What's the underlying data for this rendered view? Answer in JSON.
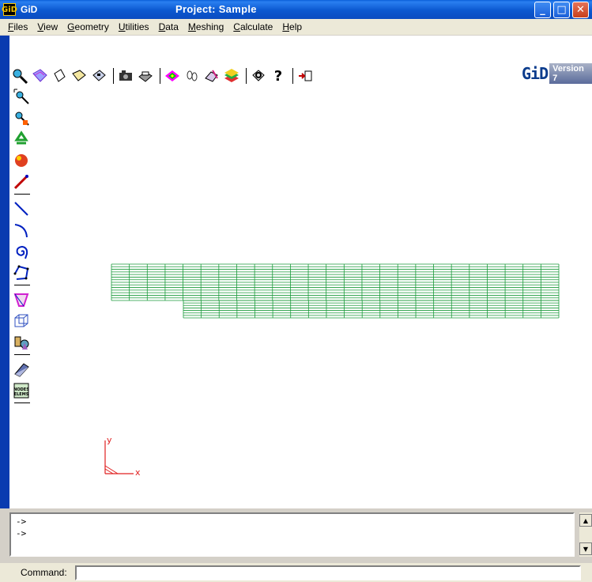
{
  "window": {
    "app_logo": "GiD",
    "app_name": "GiD",
    "title": "Project: Sample",
    "min_glyph": "_",
    "max_glyph": "□",
    "close_glyph": "✕"
  },
  "menu": [
    {
      "label": "Files",
      "mnemonic": "F",
      "rest": "iles"
    },
    {
      "label": "View",
      "mnemonic": "V",
      "rest": "iew"
    },
    {
      "label": "Geometry",
      "mnemonic": "G",
      "rest": "eometry"
    },
    {
      "label": "Utilities",
      "mnemonic": "U",
      "rest": "tilities"
    },
    {
      "label": "Data",
      "mnemonic": "D",
      "rest": "ata"
    },
    {
      "label": "Meshing",
      "mnemonic": "M",
      "rest": "eshing"
    },
    {
      "label": "Calculate",
      "mnemonic": "C",
      "rest": "alculate"
    },
    {
      "label": "Help",
      "mnemonic": "H",
      "rest": "elp"
    }
  ],
  "brand": {
    "logo": "GiD",
    "version": "Version 7"
  },
  "axis": {
    "x": "x",
    "y": "y"
  },
  "console": {
    "lines": [
      "->",
      "->"
    ]
  },
  "command": {
    "label": "Command:",
    "value": ""
  },
  "colors": {
    "mesh": "#1a9a3a",
    "axis": "#e02020",
    "titlebar": "#0a5fd8"
  },
  "icons": {
    "zoom": "zoom-icon",
    "rotate": "rotate-icon",
    "new": "new-file-icon",
    "open": "open-folder-icon",
    "save": "save-icon",
    "print": "print-icon",
    "render": "render-icon",
    "layers": "layers-icon",
    "help": "help-icon",
    "exit": "exit-icon"
  }
}
